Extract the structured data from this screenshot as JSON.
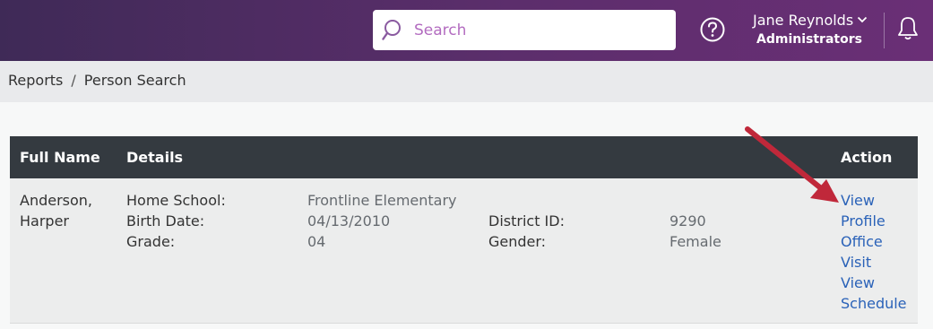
{
  "header": {
    "search": {
      "placeholder": "Search",
      "value": ""
    },
    "icons": {
      "search": "search-icon",
      "help": "help-circle-icon",
      "notifications": "bell-icon",
      "user_menu": "chevron-down-icon"
    },
    "user": {
      "name": "Jane Reynolds",
      "role": "Administrators"
    }
  },
  "breadcrumb": {
    "items": [
      "Reports",
      "Person Search"
    ],
    "separator": "/"
  },
  "table": {
    "columns": [
      "Full Name",
      "Details",
      "Action"
    ],
    "rows": [
      {
        "full_name_line1": "Anderson,",
        "full_name_line2": "Harper",
        "details": {
          "home_school_label": "Home School:",
          "home_school": "Frontline Elementary",
          "birth_date_label": "Birth Date:",
          "birth_date": "04/13/2010",
          "grade_label": "Grade:",
          "grade": "04",
          "district_id_label": "District ID:",
          "district_id": "9290",
          "gender_label": "Gender:",
          "gender": "Female"
        },
        "actions": {
          "view_profile": [
            "View",
            "Profile"
          ],
          "office_visit": [
            "Office",
            "Visit"
          ],
          "view_schedule": [
            "View",
            "Schedule"
          ]
        }
      }
    ]
  },
  "colors": {
    "header_gradient_start": "#3f2a57",
    "header_gradient_end": "#6a2f76",
    "table_header": "#343a40",
    "link": "#2a62b8",
    "annotation_arrow": "#c0283a"
  }
}
